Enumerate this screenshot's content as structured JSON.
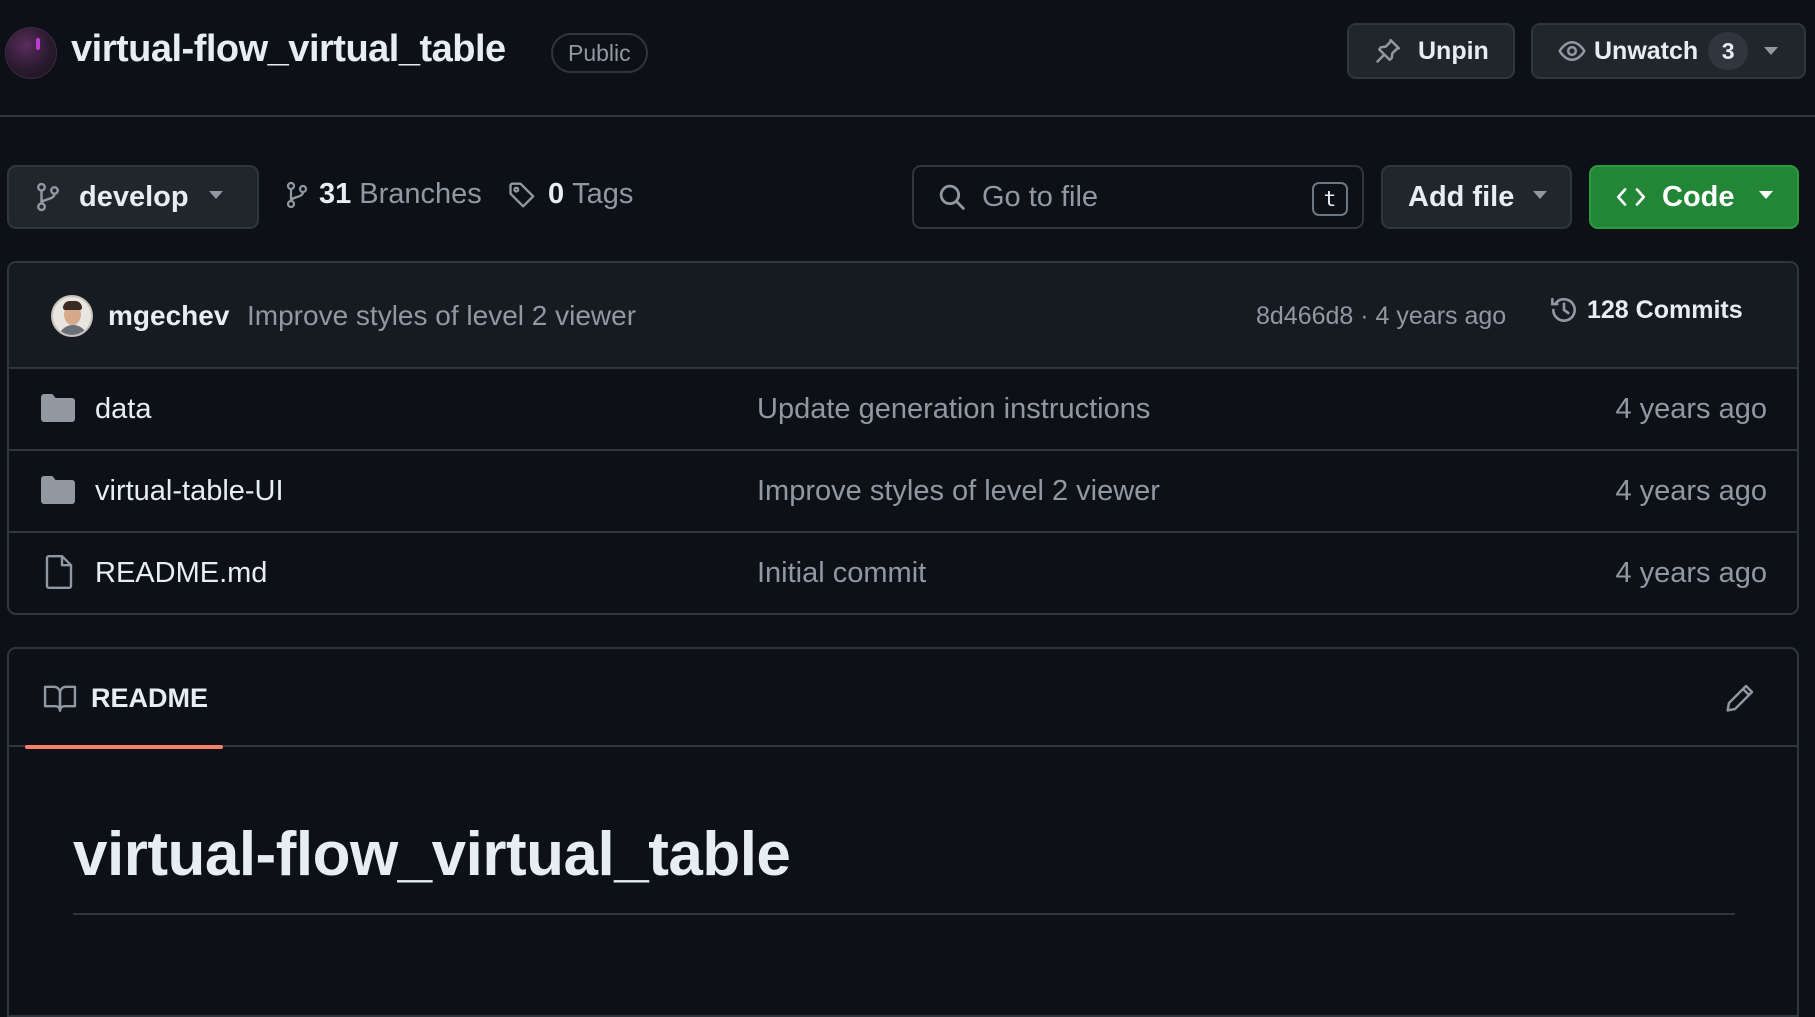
{
  "repo": {
    "title": "virtual-flow_virtual_table",
    "visibility": "Public",
    "unpin_label": "Unpin",
    "unwatch_label": "Unwatch",
    "watch_count": "3"
  },
  "toolbar": {
    "branch": "develop",
    "branches_count": "31",
    "branches_label": "Branches",
    "tags_count": "0",
    "tags_label": "Tags",
    "search_placeholder": "Go to file",
    "search_shortcut": "t",
    "add_file_label": "Add file",
    "code_label": "Code"
  },
  "latest_commit": {
    "author": "mgechev",
    "message": "Improve styles of level 2 viewer",
    "meta": "8d466d8 · 4 years ago",
    "commits_label": "128 Commits"
  },
  "files": [
    {
      "name": "data",
      "type": "folder",
      "message": "Update generation instructions",
      "date": "4 years ago"
    },
    {
      "name": "virtual-table-UI",
      "type": "folder",
      "message": "Improve styles of level 2 viewer",
      "date": "4 years ago"
    },
    {
      "name": "README.md",
      "type": "file",
      "message": "Initial commit",
      "date": "4 years ago"
    }
  ],
  "readme": {
    "tab_label": "README",
    "heading": "virtual-flow_virtual_table"
  },
  "colors": {
    "background": "#0d1117",
    "border": "#30363d",
    "code_button": "#238636",
    "tab_accent": "#f78166"
  }
}
